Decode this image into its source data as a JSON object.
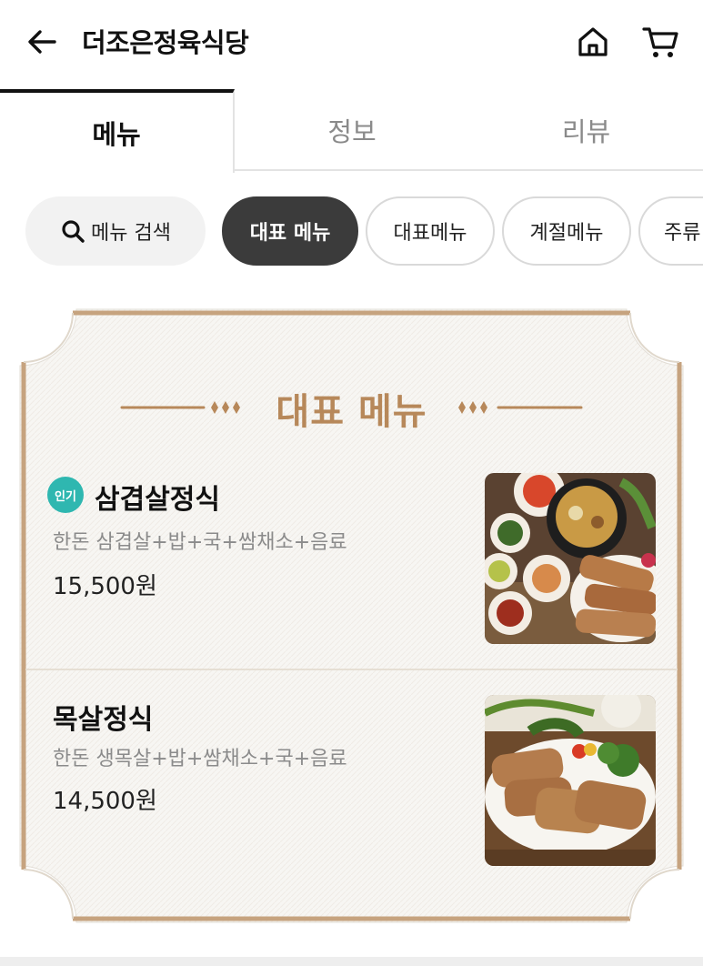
{
  "header": {
    "title": "더조은정육식당"
  },
  "tabs": [
    {
      "label": "메뉴",
      "active": true
    },
    {
      "label": "정보",
      "active": false
    },
    {
      "label": "리뷰",
      "active": false
    }
  ],
  "chips": {
    "search_label": "메뉴 검색",
    "items": [
      {
        "label": "대표 메뉴",
        "selected": true
      },
      {
        "label": "대표메뉴",
        "selected": false
      },
      {
        "label": "계절메뉴",
        "selected": false
      },
      {
        "label": "주류",
        "selected": false
      }
    ]
  },
  "menu_section": {
    "title": "대표 메뉴",
    "items": [
      {
        "badge": "인기",
        "name": "삼겹살정식",
        "description": "한돈 삼겹살+밥+국+쌈채소+음료",
        "price": "15,500원"
      },
      {
        "name": "목살정식",
        "description": "한돈 생목살+밥+쌈채소+국+음료",
        "price": "14,500원"
      }
    ]
  },
  "colors": {
    "accent_gold": "#b7885a",
    "frame_brown": "#c6a37f",
    "badge_teal": "#2fb7b0",
    "chip_selected": "#3b3b3b"
  }
}
